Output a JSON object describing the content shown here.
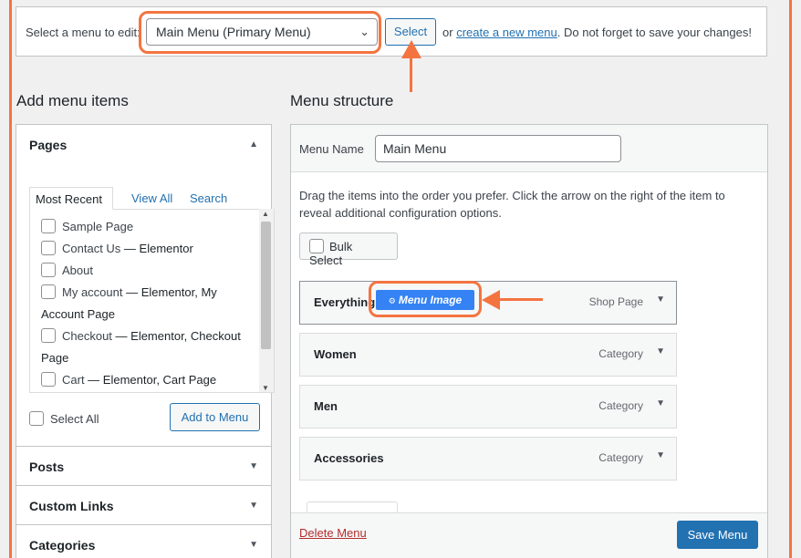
{
  "manage": {
    "label": "Select a menu to edit:",
    "selected_menu": "Main Menu (Primary Menu)",
    "select_button": "Select",
    "or_text": "or",
    "create_link": "create a new menu",
    "reminder": ". Do not forget to save your changes!"
  },
  "add_items": {
    "title": "Add menu items",
    "pages": {
      "label": "Pages",
      "tabs": [
        "Most Recent",
        "View All",
        "Search"
      ],
      "items": [
        {
          "title": "Sample Page",
          "suffix": ""
        },
        {
          "title": "Contact Us",
          "suffix": " — Elementor"
        },
        {
          "title": "About",
          "suffix": ""
        },
        {
          "title": "My account",
          "suffix": " — Elementor, My Account Page"
        },
        {
          "title": "Checkout",
          "suffix": " — Elementor, Checkout Page"
        },
        {
          "title": "Cart",
          "suffix": " — Elementor, Cart Page"
        }
      ],
      "select_all": "Select All",
      "add_button": "Add to Menu"
    },
    "sections": [
      "Posts",
      "Custom Links",
      "Categories"
    ]
  },
  "structure": {
    "title": "Menu structure",
    "menu_name_label": "Menu Name",
    "menu_name_value": "Main Menu",
    "instructions": "Drag the items into the order you prefer. Click the arrow on the right of the item to reveal additional configuration options.",
    "bulk_select": "Bulk Select",
    "items": [
      {
        "title": "Everything",
        "type": "Shop Page"
      },
      {
        "title": "Women",
        "type": "Category"
      },
      {
        "title": "Men",
        "type": "Category"
      },
      {
        "title": "Accessories",
        "type": "Category"
      }
    ],
    "menu_image_button": "Menu Image",
    "delete_menu": "Delete Menu",
    "save_menu": "Save Menu"
  },
  "colors": {
    "highlight": "#f47440",
    "primary": "#2271b1",
    "menu_image": "#3582f4",
    "delete": "#b32d2e"
  }
}
